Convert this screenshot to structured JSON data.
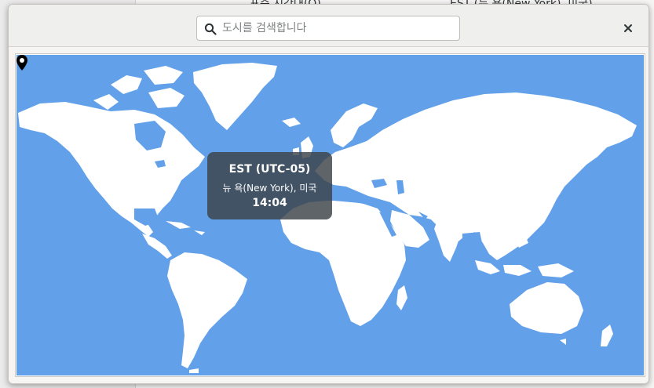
{
  "background": {
    "timezone_label": "표준 시간대(Q)",
    "timezone_value": "EST (뉴 욕(New York), 미국)"
  },
  "dialog": {
    "search": {
      "placeholder": "도시를 검색합니다",
      "value": ""
    },
    "close_icon": "close-icon"
  },
  "map": {
    "ocean_color": "#62a0ea",
    "land_color": "#ffffff",
    "selected": {
      "abbr": "EST (UTC-05)",
      "city": "뉴 욕(New York), 미국",
      "time": "14:04"
    }
  }
}
